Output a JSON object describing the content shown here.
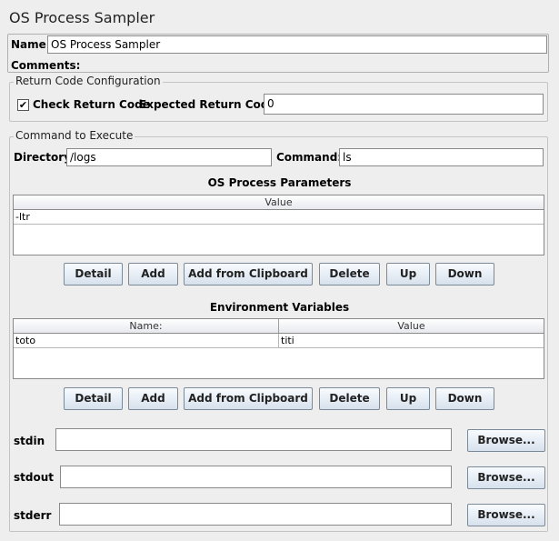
{
  "header": {
    "title": "OS Process Sampler"
  },
  "name_section": {
    "name_label": "Name:",
    "name_value": "OS Process Sampler",
    "comments_label": "Comments:"
  },
  "return_code": {
    "legend": "Return Code Configuration",
    "check_label": "Check Return Code",
    "checked": true,
    "checkmark": "✔",
    "expected_label": "Expected Return Code:",
    "expected_value": "0"
  },
  "command": {
    "legend": "Command to Execute",
    "directory_label": "Directory:",
    "directory_value": "/logs",
    "command_label": "Command:",
    "command_value": "ls"
  },
  "params": {
    "title": "OS Process Parameters",
    "columns": [
      "Value"
    ],
    "rows": [
      [
        "-ltr"
      ]
    ],
    "buttons": [
      "Detail",
      "Add",
      "Add from Clipboard",
      "Delete",
      "Up",
      "Down"
    ]
  },
  "env": {
    "title": "Environment Variables",
    "columns": [
      "Name:",
      "Value"
    ],
    "rows": [
      [
        "toto",
        "titi"
      ]
    ],
    "buttons": [
      "Detail",
      "Add",
      "Add from Clipboard",
      "Delete",
      "Up",
      "Down"
    ]
  },
  "streams": {
    "stdin_label": "stdin",
    "stdout_label": "stdout",
    "stderr_label": "stderr",
    "stdin_value": "",
    "stdout_value": "",
    "stderr_value": "",
    "browse_label": "Browse..."
  }
}
